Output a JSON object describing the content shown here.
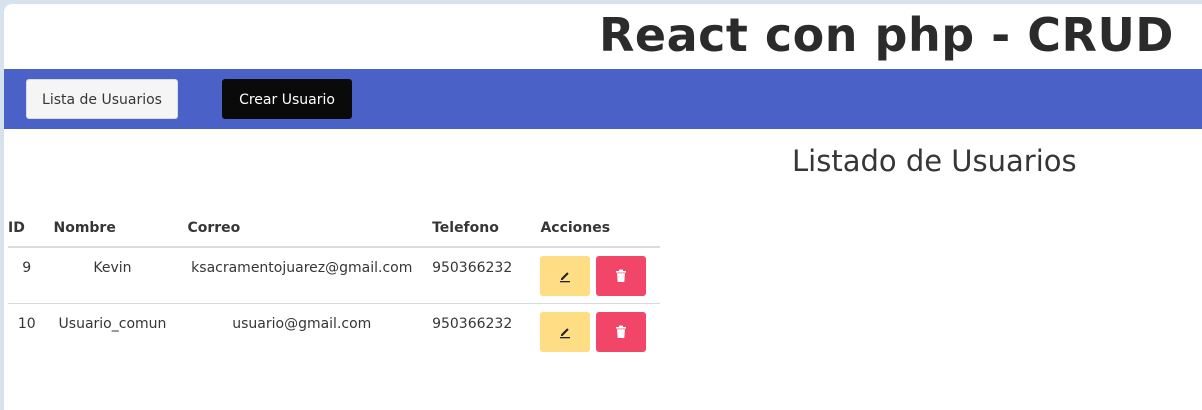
{
  "header": {
    "app_title": "React con php - CRUD"
  },
  "navbar": {
    "list_users_label": "Lista de Usuarios",
    "create_user_label": "Crear Usuario",
    "background_color": "#4a62c7"
  },
  "main": {
    "title": "Listado de Usuarios",
    "table": {
      "headers": {
        "id": "ID",
        "nombre": "Nombre",
        "correo": "Correo",
        "telefono": "Telefono",
        "acciones": "Acciones"
      },
      "rows": [
        {
          "id": "9",
          "nombre": "Kevin",
          "correo": "ksacramentojuarez@gmail.com",
          "telefono": "950366232",
          "edit_icon": "pencil-icon",
          "delete_icon": "trash-icon"
        },
        {
          "id": "10",
          "nombre": "Usuario_comun",
          "correo": "usuario@gmail.com",
          "telefono": "950366232",
          "edit_icon": "pencil-icon",
          "delete_icon": "trash-icon"
        }
      ]
    }
  },
  "colors": {
    "edit_button": "#ffdd85",
    "delete_button": "#f14668",
    "create_button": "#0a0a0a"
  }
}
